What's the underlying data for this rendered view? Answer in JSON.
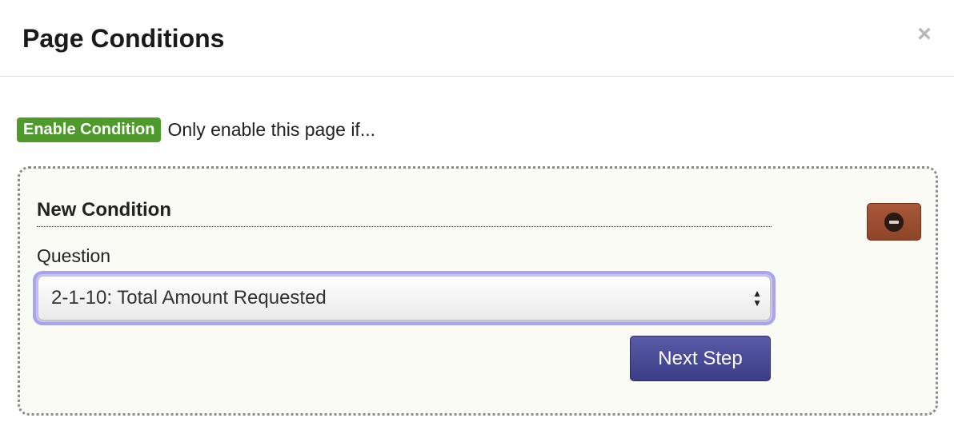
{
  "header": {
    "title": "Page Conditions",
    "close_label": "×"
  },
  "intro": {
    "badge": "Enable Condition",
    "text": "Only enable this page if..."
  },
  "condition": {
    "heading": "New Condition",
    "question_label": "Question",
    "question_value": "2-1-10: Total Amount Requested",
    "next_label": "Next Step"
  },
  "icons": {
    "close": "close-icon",
    "remove": "remove-circle-icon",
    "select_arrows": "updown-arrows-icon"
  },
  "colors": {
    "badge": "#4e9a2a",
    "remove_button": "#9b4e31",
    "next_button": "#44468f",
    "focus_ring": "#a9a4ee",
    "box_background": "#fafbf5"
  }
}
